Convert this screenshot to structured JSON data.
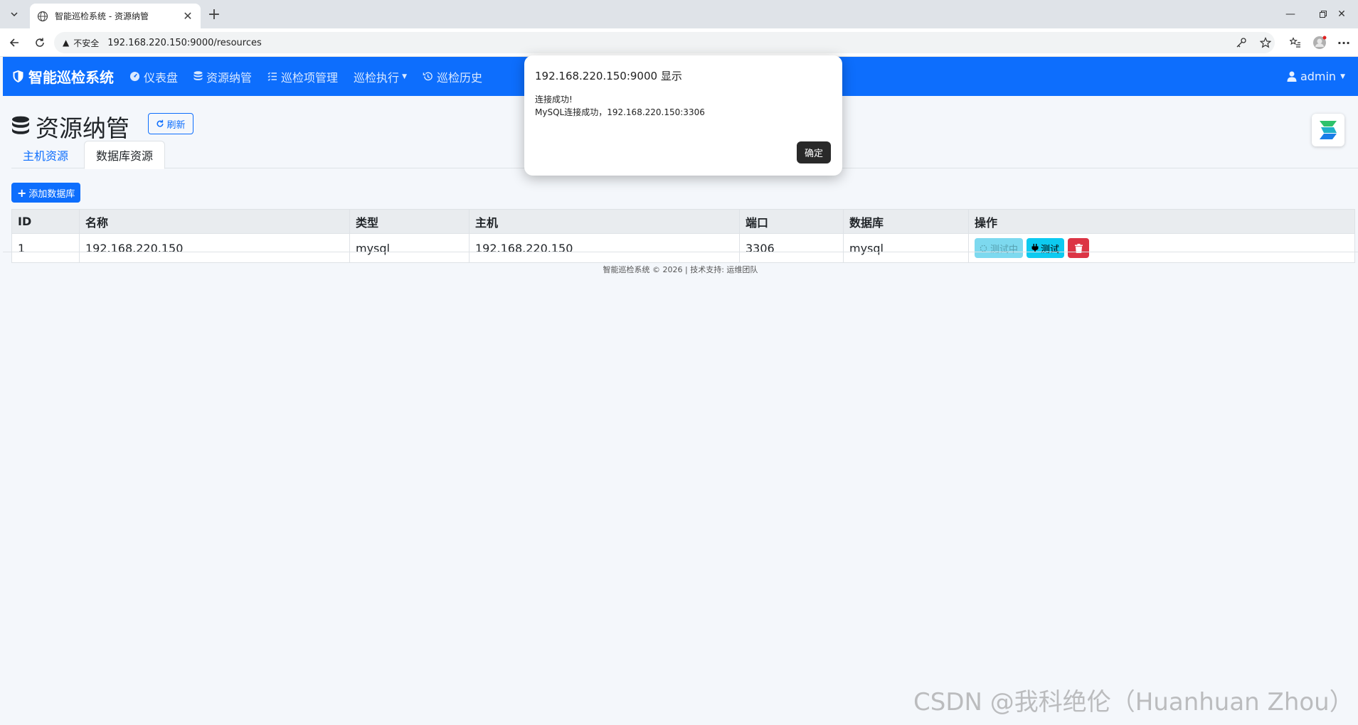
{
  "browser": {
    "tab_title": "智能巡检系统 - 资源纳管",
    "insecure_label": "不安全",
    "url": "192.168.220.150:9000/resources"
  },
  "navbar": {
    "brand": "智能巡检系统",
    "items": [
      {
        "label": "仪表盘",
        "icon": "dashboard-icon"
      },
      {
        "label": "资源纳管",
        "icon": "database-icon"
      },
      {
        "label": "巡检项管理",
        "icon": "list-icon"
      },
      {
        "label": "巡检执行",
        "icon": "none",
        "dropdown": true
      },
      {
        "label": "巡检历史",
        "icon": "history-icon"
      }
    ],
    "user": "admin"
  },
  "page": {
    "title": "资源纳管",
    "refresh_label": "刷新",
    "tabs": [
      {
        "label": "主机资源",
        "active": false
      },
      {
        "label": "数据库资源",
        "active": true
      }
    ],
    "add_button": "添加数据库"
  },
  "table": {
    "headers": [
      "ID",
      "名称",
      "类型",
      "主机",
      "端口",
      "数据库",
      "操作"
    ],
    "rows": [
      {
        "id": "1",
        "name": "192.168.220.150",
        "type": "mysql",
        "host": "192.168.220.150",
        "port": "3306",
        "database": "mysql"
      }
    ],
    "actions": {
      "testing_label": "测试中",
      "test_label": "测试"
    }
  },
  "footer": "智能巡检系统 © 2026 | 技术支持: 运维团队",
  "dialog": {
    "title": "192.168.220.150:9000 显示",
    "message_line1": "连接成功!",
    "message_line2": "MySQL连接成功，192.168.220.150:3306",
    "ok_label": "确定"
  },
  "watermark": "CSDN @我科绝伦（Huanhuan Zhou）",
  "colors": {
    "primary": "#0d6efd",
    "info": "#0dcaf0",
    "danger": "#dc3545"
  }
}
